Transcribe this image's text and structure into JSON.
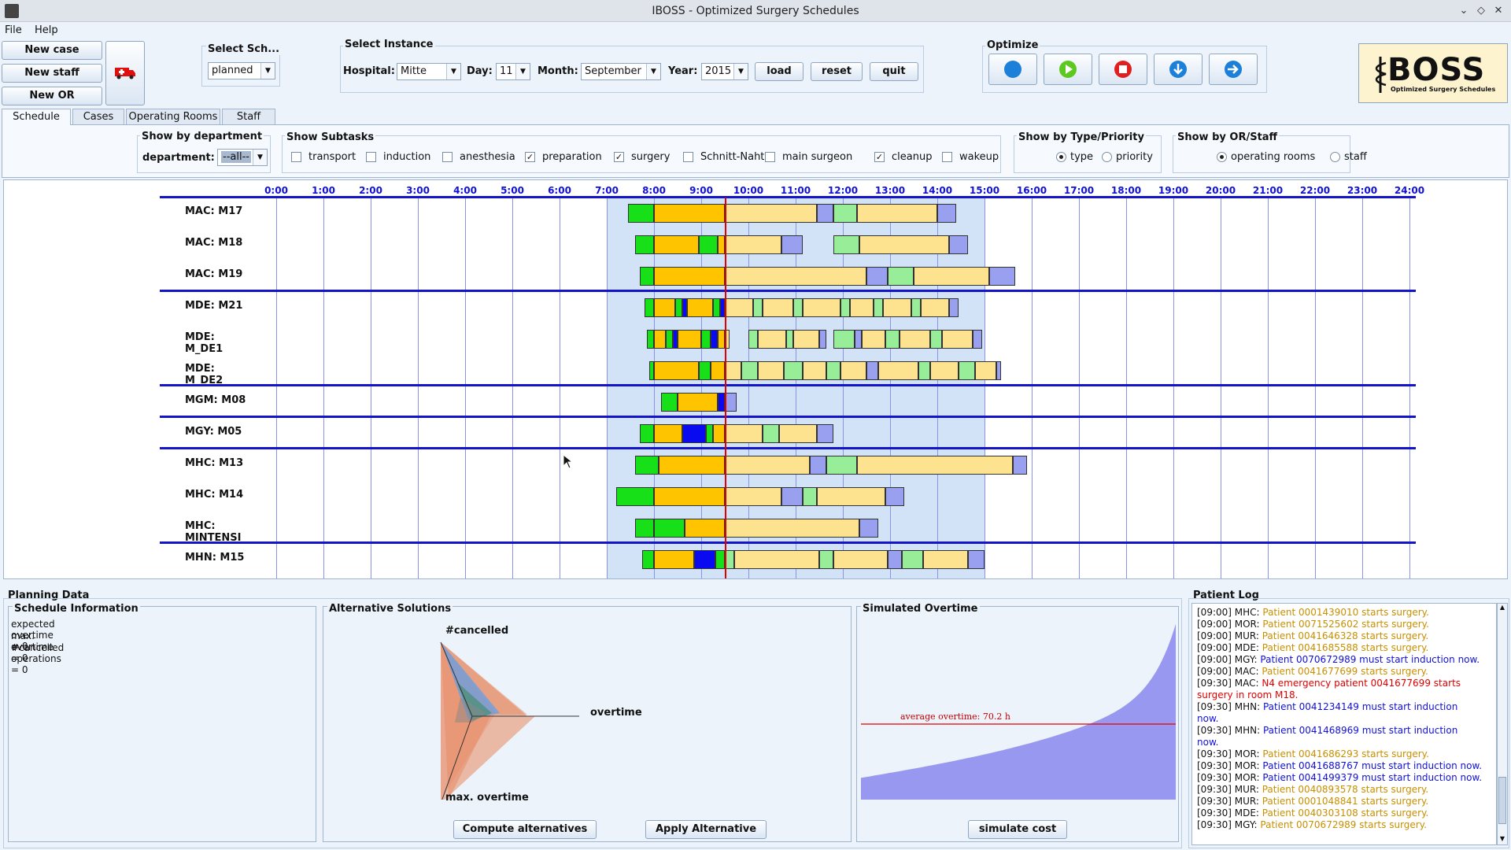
{
  "window": {
    "title": "IBOSS - Optimized Surgery Schedules"
  },
  "menu": {
    "file": "File",
    "help": "Help"
  },
  "left_buttons": {
    "new_case": "New case",
    "new_staff": "New staff",
    "new_or": "New OR"
  },
  "select_schedule": {
    "label": "Select Sch...",
    "value": "planned"
  },
  "select_instance": {
    "label": "Select Instance",
    "hospital_label": "Hospital:",
    "hospital_value": "Mitte",
    "day_label": "Day:",
    "day_value": "11",
    "month_label": "Month:",
    "month_value": "September",
    "year_label": "Year:",
    "year_value": "2015",
    "load": "load",
    "reset": "reset",
    "quit": "quit"
  },
  "optimize": {
    "label": "Optimize"
  },
  "logo": {
    "text": "BOSS",
    "subtitle": "Optimized Surgery Schedules"
  },
  "tabs": [
    {
      "label": "Schedule",
      "active": true
    },
    {
      "label": "Cases",
      "active": false
    },
    {
      "label": "Operating Rooms",
      "active": false
    },
    {
      "label": "Staff",
      "active": false
    }
  ],
  "filters": {
    "dept_group": "Show by department",
    "dept_label": "department:",
    "dept_value": "--all--",
    "subtasks_group": "Show Subtasks",
    "subtasks": [
      {
        "label": "transport",
        "checked": false
      },
      {
        "label": "induction",
        "checked": false
      },
      {
        "label": "anesthesia",
        "checked": false
      },
      {
        "label": "preparation",
        "checked": true
      },
      {
        "label": "surgery",
        "checked": true
      },
      {
        "label": "Schnitt-Naht",
        "checked": false
      },
      {
        "label": "main surgeon",
        "checked": false
      },
      {
        "label": "cleanup",
        "checked": true
      },
      {
        "label": "wakeup",
        "checked": false
      }
    ],
    "type_group": "Show by Type/Priority",
    "type_options": [
      {
        "label": "type",
        "selected": true
      },
      {
        "label": "priority",
        "selected": false
      }
    ],
    "or_group": "Show by OR/Staff",
    "or_options": [
      {
        "label": "operating rooms",
        "selected": true
      },
      {
        "label": "staff",
        "selected": false
      }
    ]
  },
  "gantt": {
    "hours": [
      "0:00",
      "1:00",
      "2:00",
      "3:00",
      "4:00",
      "5:00",
      "6:00",
      "7:00",
      "8:00",
      "9:00",
      "10:00",
      "11:00",
      "12:00",
      "13:00",
      "14:00",
      "15:00",
      "16:00",
      "17:00",
      "18:00",
      "19:00",
      "20:00",
      "21:00",
      "22:00",
      "23:00",
      "24:00"
    ],
    "current_time_hours": 9.5,
    "shift_start_hours": 7.0,
    "shift_end_hours": 15.0,
    "rows": [
      {
        "label": "MAC: M17",
        "sep_after": false,
        "blocks": [
          [
            7.45,
            8.0,
            "g"
          ],
          [
            8.0,
            9.5,
            "y"
          ],
          [
            9.5,
            11.45,
            "ly"
          ],
          [
            11.45,
            11.8,
            "p"
          ],
          [
            11.8,
            12.3,
            "lg"
          ],
          [
            12.3,
            14.0,
            "ly"
          ],
          [
            14.0,
            14.4,
            "p"
          ]
        ]
      },
      {
        "label": "MAC: M18",
        "sep_after": false,
        "blocks": [
          [
            7.6,
            8.0,
            "g"
          ],
          [
            8.0,
            8.95,
            "y"
          ],
          [
            8.95,
            9.35,
            "g"
          ],
          [
            9.35,
            9.5,
            "y"
          ],
          [
            9.5,
            10.7,
            "ly"
          ],
          [
            10.7,
            11.15,
            "p"
          ],
          [
            11.8,
            12.35,
            "lg"
          ],
          [
            12.35,
            14.25,
            "ly"
          ],
          [
            14.25,
            14.65,
            "p"
          ]
        ]
      },
      {
        "label": "MAC: M19",
        "sep_after": true,
        "blocks": [
          [
            7.7,
            8.0,
            "g"
          ],
          [
            8.0,
            9.5,
            "y"
          ],
          [
            9.5,
            12.5,
            "ly"
          ],
          [
            12.5,
            12.95,
            "p"
          ],
          [
            12.95,
            13.5,
            "lg"
          ],
          [
            13.5,
            15.1,
            "ly"
          ],
          [
            15.1,
            15.65,
            "p"
          ]
        ]
      },
      {
        "label": "MDE: M21",
        "sep_after": false,
        "blocks": [
          [
            7.8,
            8.0,
            "g"
          ],
          [
            8.0,
            8.45,
            "y"
          ],
          [
            8.45,
            8.6,
            "g"
          ],
          [
            8.6,
            8.7,
            "b"
          ],
          [
            8.7,
            9.25,
            "y"
          ],
          [
            9.25,
            9.4,
            "g"
          ],
          [
            9.4,
            9.5,
            "b"
          ],
          [
            9.5,
            10.1,
            "ly"
          ],
          [
            10.1,
            10.3,
            "lg"
          ],
          [
            10.3,
            10.95,
            "ly"
          ],
          [
            10.95,
            11.15,
            "lg"
          ],
          [
            11.15,
            11.95,
            "ly"
          ],
          [
            11.95,
            12.15,
            "lg"
          ],
          [
            12.15,
            12.65,
            "ly"
          ],
          [
            12.65,
            12.85,
            "lg"
          ],
          [
            12.85,
            13.45,
            "ly"
          ],
          [
            13.45,
            13.65,
            "lg"
          ],
          [
            13.65,
            14.25,
            "ly"
          ],
          [
            14.25,
            14.45,
            "p"
          ]
        ]
      },
      {
        "label": "MDE: M_DE1",
        "sep_after": false,
        "blocks": [
          [
            7.85,
            8.0,
            "g"
          ],
          [
            8.0,
            8.25,
            "y"
          ],
          [
            8.25,
            8.4,
            "g"
          ],
          [
            8.4,
            8.5,
            "b"
          ],
          [
            8.5,
            9.0,
            "y"
          ],
          [
            9.0,
            9.2,
            "g"
          ],
          [
            9.2,
            9.35,
            "b"
          ],
          [
            9.35,
            9.5,
            "y"
          ],
          [
            9.5,
            9.6,
            "ly"
          ],
          [
            10.0,
            10.2,
            "lg"
          ],
          [
            10.2,
            10.8,
            "ly"
          ],
          [
            10.8,
            10.95,
            "lg"
          ],
          [
            10.95,
            11.5,
            "ly"
          ],
          [
            11.5,
            11.65,
            "p"
          ],
          [
            11.8,
            12.25,
            "lg"
          ],
          [
            12.25,
            12.4,
            "p"
          ],
          [
            12.4,
            12.9,
            "ly"
          ],
          [
            12.9,
            13.2,
            "lg"
          ],
          [
            13.2,
            13.85,
            "ly"
          ],
          [
            13.85,
            14.1,
            "lg"
          ],
          [
            14.1,
            14.75,
            "ly"
          ],
          [
            14.75,
            14.95,
            "p"
          ]
        ]
      },
      {
        "label": "MDE: M_DE2",
        "sep_after": true,
        "blocks": [
          [
            7.9,
            8.0,
            "g"
          ],
          [
            8.0,
            8.95,
            "y"
          ],
          [
            8.95,
            9.2,
            "g"
          ],
          [
            9.2,
            9.5,
            "y"
          ],
          [
            9.5,
            9.85,
            "ly"
          ],
          [
            9.85,
            10.2,
            "lg"
          ],
          [
            10.2,
            10.75,
            "ly"
          ],
          [
            10.75,
            11.15,
            "lg"
          ],
          [
            11.15,
            11.65,
            "ly"
          ],
          [
            11.65,
            11.95,
            "lg"
          ],
          [
            11.95,
            12.5,
            "ly"
          ],
          [
            12.5,
            12.75,
            "p"
          ],
          [
            12.75,
            13.6,
            "ly"
          ],
          [
            13.6,
            13.85,
            "lg"
          ],
          [
            13.85,
            14.45,
            "ly"
          ],
          [
            14.45,
            14.8,
            "lg"
          ],
          [
            14.8,
            15.25,
            "ly"
          ],
          [
            15.25,
            15.35,
            "p"
          ]
        ]
      },
      {
        "label": "MGM: M08",
        "sep_after": true,
        "blocks": [
          [
            8.15,
            8.5,
            "g"
          ],
          [
            8.5,
            9.35,
            "y"
          ],
          [
            9.35,
            9.5,
            "b"
          ],
          [
            9.5,
            9.75,
            "p"
          ]
        ]
      },
      {
        "label": "MGY: M05",
        "sep_after": true,
        "blocks": [
          [
            7.7,
            8.0,
            "g"
          ],
          [
            8.0,
            8.6,
            "y"
          ],
          [
            8.6,
            9.1,
            "b"
          ],
          [
            9.1,
            9.25,
            "g"
          ],
          [
            9.25,
            9.5,
            "y"
          ],
          [
            9.5,
            10.3,
            "ly"
          ],
          [
            10.3,
            10.65,
            "lg"
          ],
          [
            10.65,
            11.45,
            "ly"
          ],
          [
            11.45,
            11.8,
            "p"
          ]
        ]
      },
      {
        "label": "MHC: M13",
        "sep_after": false,
        "blocks": [
          [
            7.6,
            8.1,
            "g"
          ],
          [
            8.1,
            9.5,
            "y"
          ],
          [
            9.5,
            11.3,
            "ly"
          ],
          [
            11.3,
            11.65,
            "p"
          ],
          [
            11.65,
            12.3,
            "lg"
          ],
          [
            12.3,
            15.6,
            "ly"
          ],
          [
            15.6,
            15.9,
            "p"
          ]
        ]
      },
      {
        "label": "MHC: M14",
        "sep_after": false,
        "blocks": [
          [
            7.2,
            8.0,
            "g"
          ],
          [
            8.0,
            9.5,
            "y"
          ],
          [
            9.5,
            10.7,
            "ly"
          ],
          [
            10.7,
            11.15,
            "p"
          ],
          [
            11.15,
            11.45,
            "lg"
          ],
          [
            11.45,
            12.9,
            "ly"
          ],
          [
            12.9,
            13.3,
            "p"
          ]
        ]
      },
      {
        "label": "MHC: MINTENSI",
        "sep_after": true,
        "blocks": [
          [
            7.6,
            8.0,
            "g"
          ],
          [
            8.0,
            8.65,
            "g"
          ],
          [
            8.65,
            9.5,
            "y"
          ],
          [
            9.5,
            12.35,
            "ly"
          ],
          [
            12.35,
            12.75,
            "p"
          ]
        ]
      },
      {
        "label": "MHN: M15",
        "sep_after": false,
        "blocks": [
          [
            7.75,
            8.0,
            "g"
          ],
          [
            8.0,
            8.85,
            "y"
          ],
          [
            8.85,
            9.3,
            "b"
          ],
          [
            9.3,
            9.5,
            "g"
          ],
          [
            9.5,
            9.7,
            "lg"
          ],
          [
            9.7,
            11.5,
            "ly"
          ],
          [
            11.5,
            11.8,
            "lg"
          ],
          [
            11.8,
            12.95,
            "ly"
          ],
          [
            12.95,
            13.25,
            "p"
          ],
          [
            13.25,
            13.7,
            "lg"
          ],
          [
            13.7,
            14.65,
            "ly"
          ],
          [
            14.65,
            15.0,
            "p"
          ]
        ]
      }
    ]
  },
  "planning": {
    "title": "Planning Data",
    "schedule_info": {
      "title": "Schedule Information",
      "lines": [
        "expected overtime = 0",
        "max. overtime = 0",
        "#cancelled operations = 0"
      ]
    },
    "alternatives": {
      "title": "Alternative Solutions",
      "axis_cancelled": "#cancelled",
      "axis_overtime": "overtime",
      "axis_max_overtime": "max. overtime",
      "compute": "Compute alternatives",
      "apply": "Apply Alternative"
    },
    "overtime": {
      "title": "Simulated Overtime",
      "avg_label": "average overtime: 70.2 h",
      "button": "simulate cost"
    }
  },
  "patient_log": {
    "title": "Patient Log",
    "entries": [
      {
        "prefix": "[09:00] MHC: ",
        "text": "Patient 0001439010 starts surgery.",
        "color": "#c89000"
      },
      {
        "prefix": "[09:00] MOR: ",
        "text": "Patient 0071525602 starts surgery.",
        "color": "#c89000"
      },
      {
        "prefix": "[09:00] MUR: ",
        "text": "Patient 0041646328 starts surgery.",
        "color": "#c89000"
      },
      {
        "prefix": "[09:00] MDE: ",
        "text": "Patient 0041685588 starts surgery.",
        "color": "#c89000"
      },
      {
        "prefix": "[09:00] MGY: ",
        "text": "Patient 0070672989 must start induction now.",
        "color": "#1010d8"
      },
      {
        "prefix": "[09:00] MAC: ",
        "text": "Patient 0041677699 starts surgery.",
        "color": "#c89000"
      },
      {
        "prefix": "[09:30] MAC: ",
        "text": "N4 emergency patient 0041677699 starts",
        "color": "#e00000"
      },
      {
        "prefix": "",
        "text": "surgery in room M18.",
        "color": "#e00000"
      },
      {
        "prefix": "[09:30] MHN: ",
        "text": "Patient 0041234149 must start induction",
        "color": "#1010d8"
      },
      {
        "prefix": "",
        "text": "now.",
        "color": "#1010d8"
      },
      {
        "prefix": "[09:30] MHN: ",
        "text": "Patient 0041468969 must start induction",
        "color": "#1010d8"
      },
      {
        "prefix": "",
        "text": "now.",
        "color": "#1010d8"
      },
      {
        "prefix": "[09:30] MOR: ",
        "text": "Patient 0041686293 starts surgery.",
        "color": "#c89000"
      },
      {
        "prefix": "[09:30] MOR: ",
        "text": "Patient 0041688767 must start induction now.",
        "color": "#1010d8"
      },
      {
        "prefix": "[09:30] MOR: ",
        "text": "Patient 0041499379 must start induction now.",
        "color": "#1010d8"
      },
      {
        "prefix": "[09:30] MUR: ",
        "text": "Patient 0040893578 starts surgery.",
        "color": "#c89000"
      },
      {
        "prefix": "[09:30] MUR: ",
        "text": "Patient 0001048841 starts surgery.",
        "color": "#c89000"
      },
      {
        "prefix": "[09:30] MDE: ",
        "text": "Patient 0040303108 starts surgery.",
        "color": "#c89000"
      },
      {
        "prefix": "[09:30] MGY: ",
        "text": "Patient 0070672989 starts surgery.",
        "color": "#c89000"
      }
    ]
  },
  "colors": {
    "green": "#18e018",
    "yellow": "#ffc400",
    "light_yellow": "#fde38f",
    "purple": "#9aa0f0",
    "light_green": "#98ee98",
    "blue": "#0a0af0",
    "shift_bg": "#d3e3f7",
    "now_line": "#e00000",
    "grid_blue": "#1414c8"
  }
}
